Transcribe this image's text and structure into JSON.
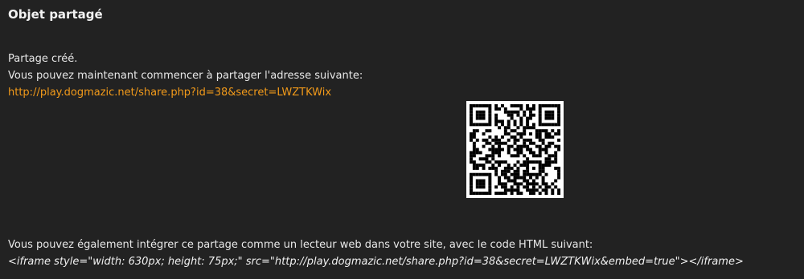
{
  "share": {
    "title": "Objet partagé",
    "created_text": "Partage créé.",
    "instruction_text": "Vous pouvez maintenant commencer à partager l'adresse suivante:",
    "share_url": "http://play.dogmazic.net/share.php?id=38&secret=LWZTKWix",
    "qr_code": {
      "icon": "qr-code-icon",
      "encoded_url": "http://play.dogmazic.net/share.php?id=38&secret=LWZTKWix"
    },
    "embed_text": "Vous pouvez également intégrer ce partage comme un lecteur web dans votre site, avec le code HTML suivant:",
    "embed_code": "<iframe style=\"width: 630px; height: 75px;\" src=\"http://play.dogmazic.net/share.php?id=38&secret=LWZTKWix&embed=true\"></iframe>"
  },
  "colors": {
    "background": "#222222",
    "text": "#e8e8e8",
    "link": "#f29a1a"
  }
}
